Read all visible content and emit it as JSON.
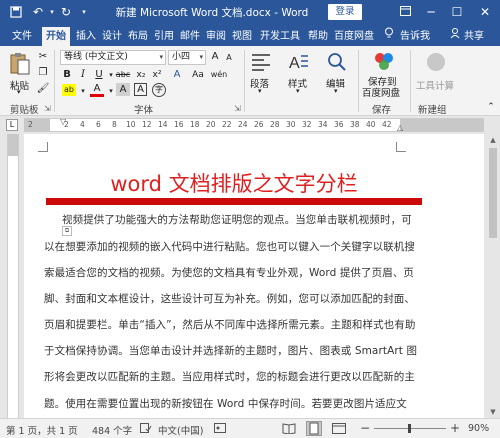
{
  "titlebar": {
    "title": "新建 Microsoft Word 文档.docx  -  Word",
    "login": "登录",
    "restore_icon": "ribbon-display-icon",
    "minimize": "─",
    "maximize": "☐",
    "close": "✕"
  },
  "tabs": [
    {
      "label": "文件"
    },
    {
      "label": "开始"
    },
    {
      "label": "插入"
    },
    {
      "label": "设计"
    },
    {
      "label": "布局"
    },
    {
      "label": "引用"
    },
    {
      "label": "邮件"
    },
    {
      "label": "审阅"
    },
    {
      "label": "视图"
    },
    {
      "label": "开发工具"
    },
    {
      "label": "帮助"
    },
    {
      "label": "百度网盘"
    },
    {
      "label": "告诉我"
    },
    {
      "label": "共享"
    }
  ],
  "ribbon": {
    "clipboard": {
      "paste": "粘贴",
      "group": "剪贴板"
    },
    "font": {
      "font_name": "等线 (中文正文)",
      "font_size": "小四",
      "group": "字体",
      "bold": "B",
      "italic": "I",
      "underline": "U",
      "strike": "abc",
      "sub": "x₂",
      "sup": "x²",
      "grow": "A",
      "shrink": "A",
      "aa": "Aa",
      "clear": "A",
      "wen": "wén",
      "charbox": "A",
      "highlight": "ab",
      "fontcolor": "A",
      "shade": "A",
      "circle": "字"
    },
    "paragraph": {
      "label": "段落"
    },
    "styles": {
      "label": "样式"
    },
    "editing": {
      "label": "编辑"
    },
    "save": {
      "line1": "保存到",
      "line2": "百度网盘",
      "group": "保存"
    },
    "new": {
      "label": "工具计算",
      "group": "新建组"
    }
  },
  "ruler": {
    "tab_marker": "L",
    "numbers": [
      "2",
      "2",
      "4",
      "6",
      "8",
      "10",
      "12",
      "14",
      "16",
      "18",
      "20",
      "22",
      "24",
      "26",
      "28",
      "30",
      "32",
      "34",
      "36",
      "38",
      "40",
      "42"
    ]
  },
  "document": {
    "heading": "word 文档排版之文字分栏",
    "lines": [
      "视频提供了功能强大的方法帮助您证明您的观点。当您单击联机视频时，可",
      "以在想要添加的视频的嵌入代码中进行粘贴。您也可以键入一个关键字以联机搜",
      "索最适合您的文档的视频。为使您的文档具有专业外观，Word 提供了页眉、页",
      "脚、封面和文本框设计，这些设计可互为补充。例如，您可以添加匹配的封面、",
      "页眉和提要栏。单击“插入”，然后从不同库中选择所需元素。主题和样式也有助",
      "于文档保持协调。当您单击设计并选择新的主题时，图片、图表或 SmartArt 图",
      "形将会更改以匹配新的主题。当应用样式时，您的标题会进行更改以匹配新的主",
      "题。使用在需要位置出现的新按钮在 Word 中保存时间。若要更改图片适应文"
    ]
  },
  "status": {
    "page": "第 1 页，共 1 页",
    "words": "484 个字",
    "lang": "中文(中国)",
    "zoom_minus": "−",
    "zoom_plus": "+",
    "zoom": "90%"
  },
  "colors": {
    "accent": "#2b579a",
    "heading": "#e02020",
    "bar": "#cc0a0a"
  }
}
